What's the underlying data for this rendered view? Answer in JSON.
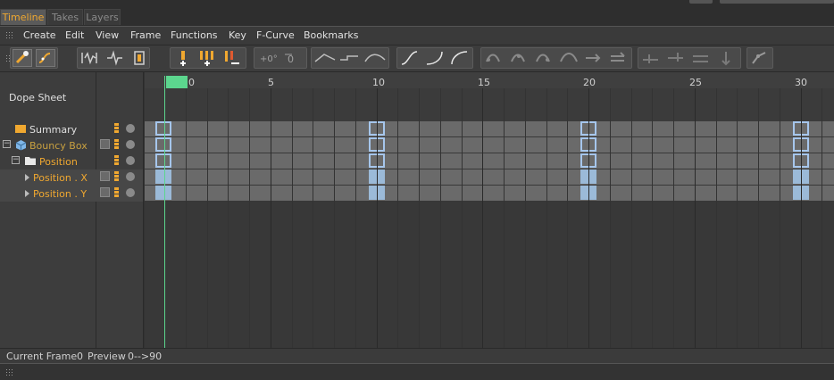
{
  "tabs": [
    {
      "label": "Timeline",
      "active": true
    },
    {
      "label": "Takes",
      "active": false
    },
    {
      "label": "Layers",
      "active": false
    }
  ],
  "menu": [
    "Create",
    "Edit",
    "View",
    "Frame",
    "Functions",
    "Key",
    "F-Curve",
    "Bookmarks"
  ],
  "toolbar": {
    "groups": [
      {
        "name": "key-mode-group",
        "icons": [
          "key-mode-icon",
          "fcurve-mode-icon"
        ]
      },
      {
        "name": "view-mode-group",
        "icons": [
          "waveform-icon",
          "pulse-icon",
          "track-icon"
        ]
      },
      {
        "name": "key-add-group",
        "icons": [
          "add-key-icon",
          "add-keys-icon",
          "remove-key-icon"
        ]
      },
      {
        "name": "zero-group",
        "icons": [
          "zero-angle-icon",
          "zero-length-icon"
        ]
      },
      {
        "name": "interp-group",
        "icons": [
          "linear-interp-icon",
          "step-interp-icon",
          "spline-interp-icon"
        ]
      },
      {
        "name": "ease-group",
        "icons": [
          "ease-inout-icon",
          "ease-in-icon",
          "ease-out-icon"
        ]
      },
      {
        "name": "clamp-group",
        "icons": [
          "clamp-1-icon",
          "clamp-2-icon",
          "clamp-3-icon",
          "clamp-4-icon",
          "clamp-5-icon",
          "clamp-6-icon"
        ]
      },
      {
        "name": "break-group",
        "icons": [
          "break-1-icon",
          "break-2-icon",
          "break-3-icon",
          "break-4-icon"
        ]
      },
      {
        "name": "extra-group",
        "icons": [
          "ik-icon"
        ]
      }
    ]
  },
  "left_panel": {
    "title": "Dope Sheet",
    "tracks": [
      {
        "label": "Summary",
        "icon": "folder-icon",
        "color": "#e0e0e0",
        "indent": 0,
        "expander": false
      },
      {
        "label": "Bouncy Box",
        "icon": "cube-icon",
        "color": "#c8a040",
        "indent": 1,
        "expander": true
      },
      {
        "label": "Position",
        "icon": "open-folder-icon",
        "color": "#f0a830",
        "indent": 2,
        "expander": true
      },
      {
        "label": "Position . X",
        "icon": "",
        "color": "#f0a830",
        "indent": 3,
        "expander": false
      },
      {
        "label": "Position . Y",
        "icon": "",
        "color": "#f0a830",
        "indent": 3,
        "expander": false
      }
    ]
  },
  "ruler": {
    "labels": [
      "0",
      "5",
      "10",
      "15",
      "20",
      "25",
      "30"
    ],
    "current_frame_marker": "0"
  },
  "keys": {
    "frames": [
      0,
      10,
      20,
      30
    ],
    "rows": [
      "summary",
      "object",
      "position",
      "position-x",
      "position-y"
    ]
  },
  "status": {
    "current_frame_label": "Current Frame",
    "current_frame_value": "0",
    "preview_label": "Preview",
    "preview_value": "0-->90"
  },
  "colors": {
    "accent": "#f0a830",
    "playhead": "#5cd68e",
    "key_border": "#a6c6ec",
    "key_fill": "#9bbad8",
    "track_bar": "#6a6a6a"
  }
}
